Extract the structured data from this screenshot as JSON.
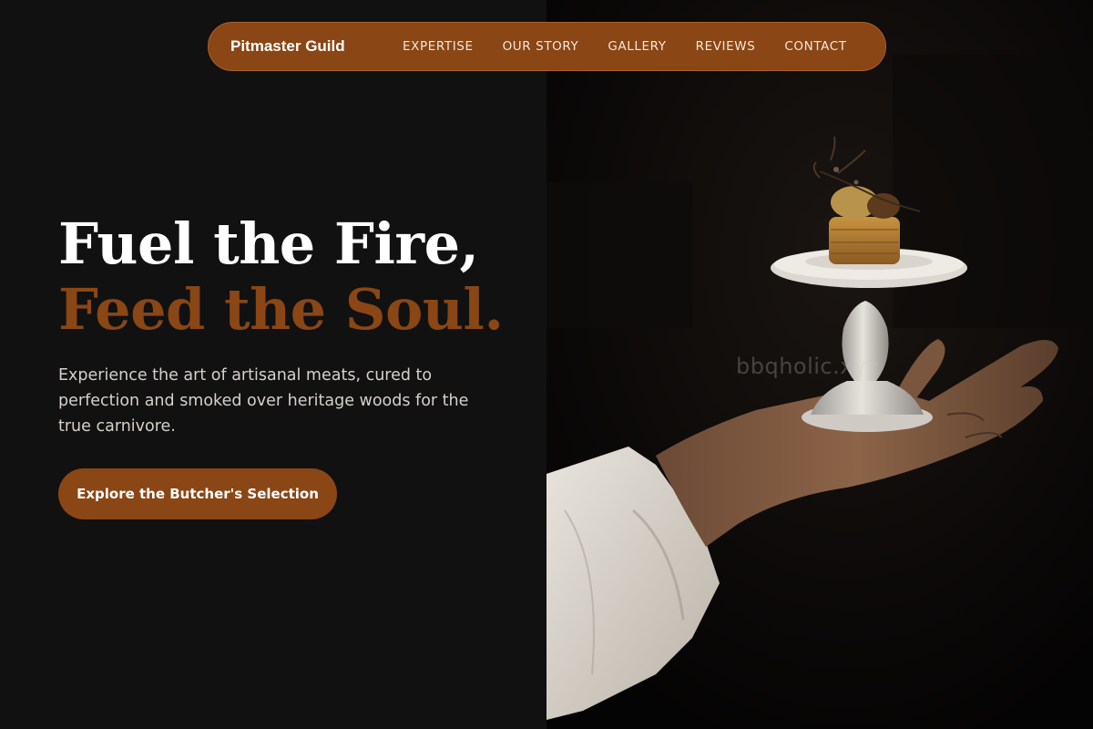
{
  "nav": {
    "brand": "Pitmaster Guild",
    "links": [
      "EXPERTISE",
      "OUR STORY",
      "GALLERY",
      "REVIEWS",
      "CONTACT"
    ]
  },
  "hero": {
    "headline_line1": "Fuel the Fire,",
    "headline_line2": "Feed the Soul.",
    "subtext": "Experience the art of artisanal meats, cured to perfection and smoked over heritage woods for the true carnivore.",
    "cta_label": "Explore the Butcher's Selection"
  },
  "image": {
    "watermark": "bbqholic.xyz",
    "subject": "chef-hand-presenting-appetizer-on-pedestal-plate"
  },
  "colors": {
    "background": "#111111",
    "accent": "#8a4615",
    "headline": "#ffffff",
    "body_text": "#d6d0ca"
  }
}
